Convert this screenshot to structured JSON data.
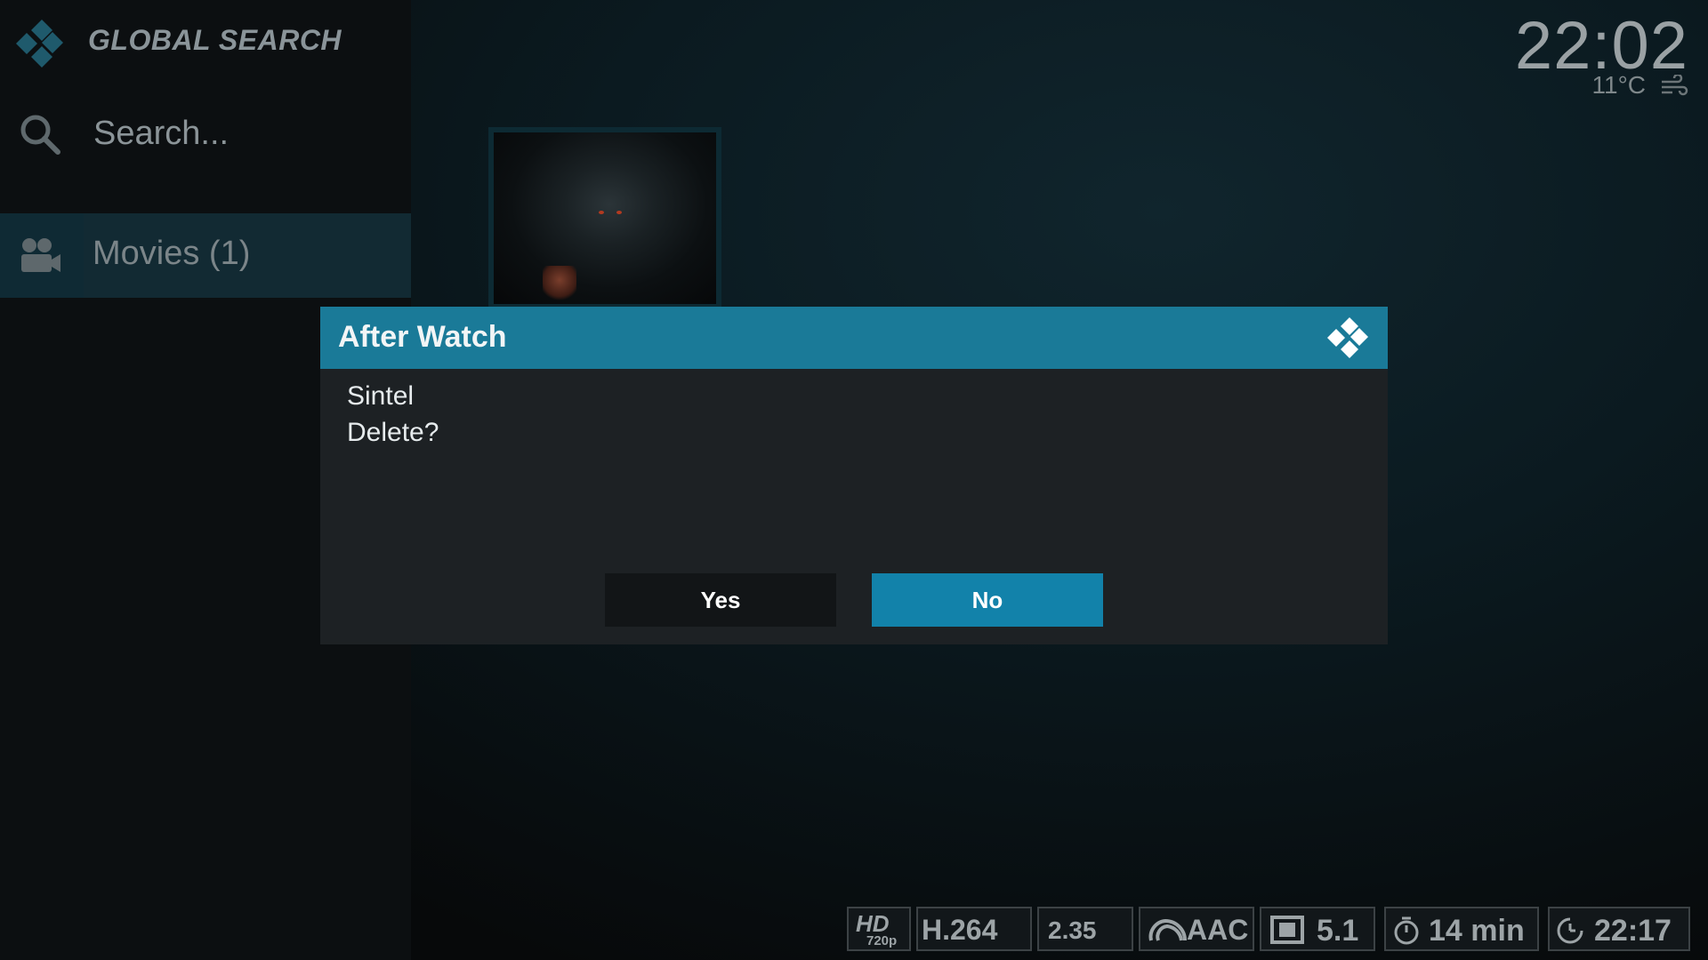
{
  "app": {
    "title": "GLOBAL SEARCH",
    "logo_icon": "kodi-logo-icon"
  },
  "search": {
    "icon": "search-icon",
    "placeholder": "Search..."
  },
  "nav": {
    "items": [
      {
        "label": "Movies (1)",
        "icon": "movie-camera-icon",
        "selected": true
      }
    ]
  },
  "clock": {
    "time": "22:02",
    "temperature": "11°C",
    "weather_icon": "wind-icon"
  },
  "dialog": {
    "title": "After Watch",
    "logo_icon": "kodi-logo-icon",
    "lines": [
      "Sintel",
      "Delete?"
    ],
    "yes_label": "Yes",
    "no_label": "No",
    "focused_button": "No"
  },
  "media_flags": {
    "resolution_top": "HD",
    "resolution_bottom": "720p",
    "codec": "H.264",
    "aspect_ratio": "2.35",
    "audio_codec": "AAC",
    "audio_channels": "5.1",
    "runtime": "14 min",
    "end_time": "22:17"
  },
  "colors": {
    "accent": "#1a7a98",
    "focused_button": "#1282aa",
    "dialog_bg": "#1d2124",
    "sidebar_selected": "#122a33"
  }
}
